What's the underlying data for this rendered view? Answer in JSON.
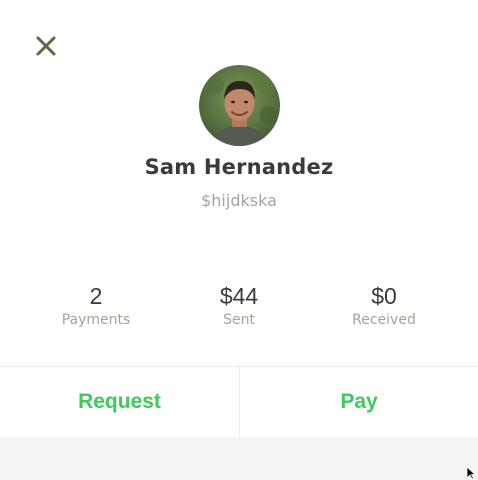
{
  "header": {
    "close_icon": "close-icon"
  },
  "profile": {
    "name": "Sam Hernandez",
    "handle": "$hijdkska",
    "avatar_icon": "avatar-photo"
  },
  "stats": [
    {
      "value": "2",
      "label": "Payments"
    },
    {
      "value": "$44",
      "label": "Sent"
    },
    {
      "value": "$0",
      "label": "Received"
    }
  ],
  "actions": {
    "request_label": "Request",
    "pay_label": "Pay"
  },
  "colors": {
    "accent_green": "#3fc95a",
    "text_dark": "#3b3a34",
    "text_muted": "#a8a39a",
    "close_icon": "#6b6048"
  }
}
